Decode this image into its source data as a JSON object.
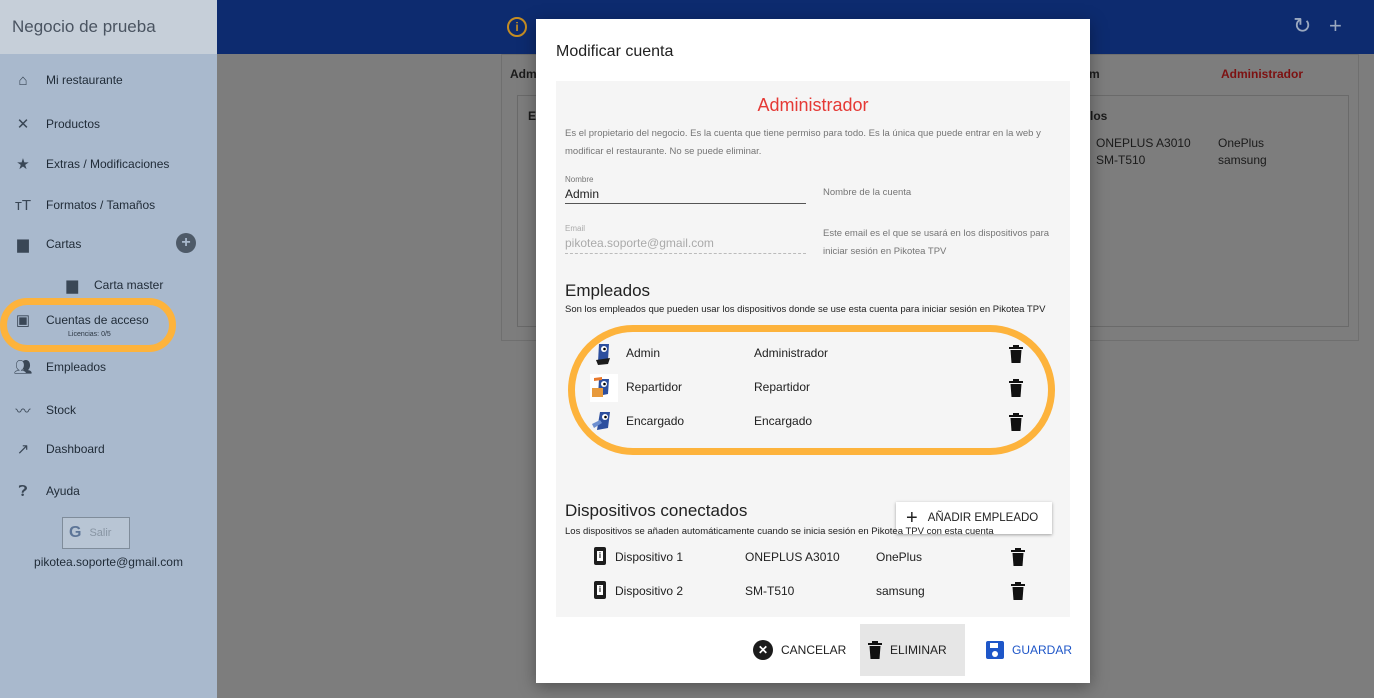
{
  "sidebar": {
    "business_name": "Negocio de prueba",
    "items": [
      {
        "label": "Mi restaurante",
        "icon": "home-icon"
      },
      {
        "label": "Productos",
        "icon": "utensils-icon"
      },
      {
        "label": "Extras / Modificaciones",
        "icon": "star-icon"
      },
      {
        "label": "Formatos / Tamaños",
        "icon": "text-size-icon"
      },
      {
        "label": "Cartas",
        "icon": "menu-book-icon"
      },
      {
        "label": "Carta master",
        "icon": "menu-book-icon"
      },
      {
        "label": "Cuentas de acceso",
        "icon": "devices-icon"
      },
      {
        "label": "Empleados",
        "icon": "people-icon"
      },
      {
        "label": "Stock",
        "icon": "trend-icon"
      },
      {
        "label": "Dashboard",
        "icon": "chart-up-icon"
      },
      {
        "label": "Ayuda",
        "icon": "help-icon"
      }
    ],
    "licenses": "Licencias: 0/5",
    "google_label": "Salir",
    "email": "pikotea.soporte@gmail.com"
  },
  "background": {
    "col_account": "Adm",
    "col_m": "m",
    "col_role": "Administrador",
    "card_e": "E",
    "card_devices_title": "los",
    "devices": [
      {
        "model": "ONEPLUS A3010",
        "brand": "OnePlus"
      },
      {
        "model": "SM-T510",
        "brand": "samsung"
      }
    ]
  },
  "modal": {
    "title": "Modificar cuenta",
    "role_title": "Administrador",
    "role_description": "Es el propietario del negocio. Es la cuenta que tiene permiso para todo. Es la única que puede entrar en la web y modificar el restaurante. No se puede eliminar.",
    "name_label": "Nombre",
    "name_value": "Admin",
    "name_help": "Nombre de la cuenta",
    "email_label": "Email",
    "email_value": "pikotea.soporte@gmail.com",
    "email_help": "Este email es el que se usará en los dispositivos para iniciar sesión en Pikotea TPV",
    "employees_title": "Empleados",
    "employees_desc": "Son los empleados que pueden usar los dispositivos donde se use esta cuenta para iniciar sesión en Pikotea TPV",
    "employees": [
      {
        "name": "Admin",
        "role": "Administrador"
      },
      {
        "name": "Repartidor",
        "role": "Repartidor"
      },
      {
        "name": "Encargado",
        "role": "Encargado"
      }
    ],
    "add_employee_label": "AÑADIR EMPLEADO",
    "devices_title": "Dispositivos conectados",
    "devices_desc": "Los dispositivos se añaden automáticamente cuando se inicia sesión en Pikotea TPV con esta cuenta",
    "devices": [
      {
        "name": "Dispositivo 1",
        "model": "ONEPLUS A3010",
        "brand": "OnePlus"
      },
      {
        "name": "Dispositivo 2",
        "model": "SM-T510",
        "brand": "samsung"
      }
    ],
    "cancel_label": "CANCELAR",
    "delete_label": "ELIMINAR",
    "save_label": "GUARDAR"
  },
  "colors": {
    "accent": "#1e56c8",
    "role_title": "#e53935",
    "highlight": "#fdb33c",
    "topbar": "#0d2b6f"
  }
}
